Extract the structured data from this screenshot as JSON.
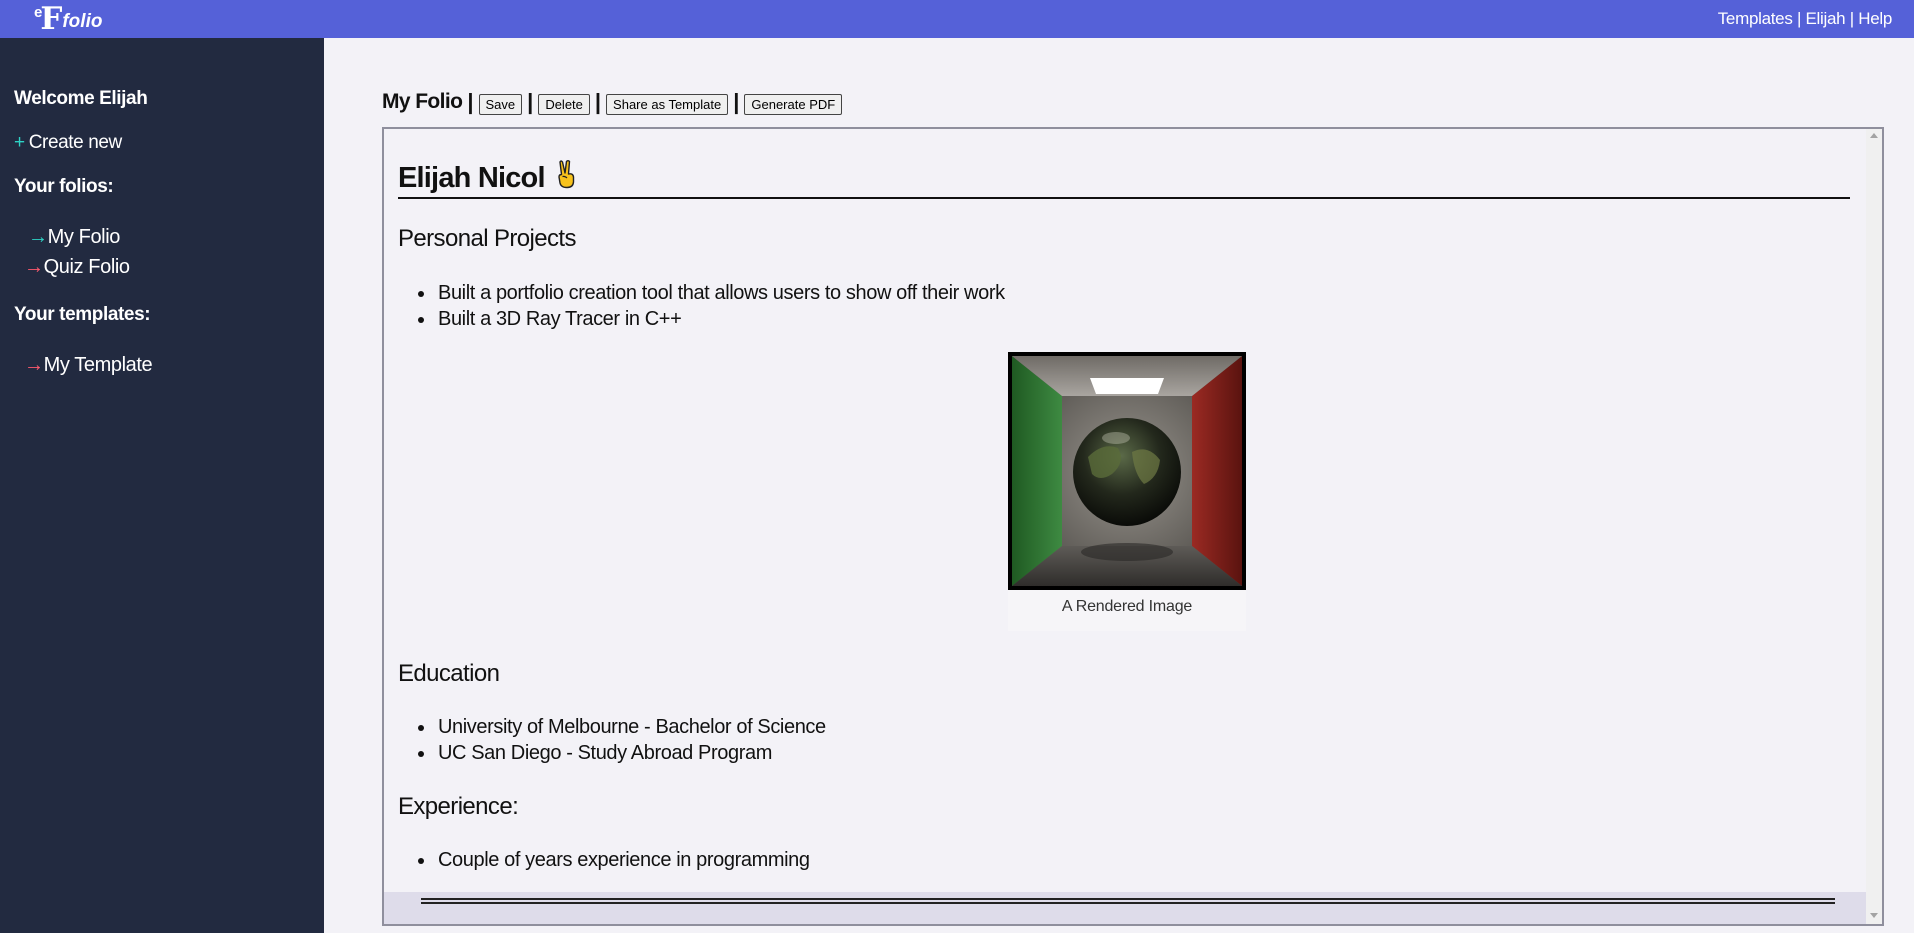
{
  "header": {
    "logo_e": "e",
    "logo_f": "F",
    "logo_word": "folio",
    "nav": [
      {
        "label": "Templates"
      },
      {
        "label": "Elijah"
      },
      {
        "label": "Help"
      }
    ],
    "separator": " | "
  },
  "sidebar": {
    "welcome": "Welcome Elijah",
    "create_plus": "+",
    "create_label": "Create new",
    "folios_heading": "Your folios:",
    "folios": [
      {
        "arrow": "→",
        "label": "My Folio",
        "arrow_color": "#2ed3c6"
      },
      {
        "arrow": "→",
        "label": "Quiz Folio",
        "arrow_color": "#ff5a6e"
      }
    ],
    "templates_heading": "Your templates:",
    "templates": [
      {
        "arrow": "→",
        "label": "My Template",
        "arrow_color": "#ff5a6e"
      }
    ]
  },
  "toolbar": {
    "title": "My Folio",
    "sep": "|",
    "save_label": "Save",
    "delete_label": "Delete",
    "share_label": "Share as Template",
    "pdf_label": "Generate PDF"
  },
  "document": {
    "name": "Elijah Nicol",
    "emoji": "victory-hand-icon",
    "sections": [
      {
        "heading": "Personal Projects",
        "items": [
          "Built a portfolio creation tool that allows users to show off their work",
          "Built a 3D Ray Tracer in C++"
        ]
      },
      {
        "heading": "Education",
        "items": [
          "University of Melbourne - Bachelor of Science",
          "UC San Diego - Study Abroad Program"
        ]
      },
      {
        "heading": "Experience:",
        "items": [
          "Couple of years experience in programming"
        ]
      }
    ],
    "figure_caption": "A Rendered Image"
  },
  "colors": {
    "topbar": "#5561d8",
    "sidebar": "#222a40",
    "accent_cyan": "#2ed3c6",
    "accent_red": "#ff5a6e",
    "page_bg": "#f3f2f7"
  }
}
